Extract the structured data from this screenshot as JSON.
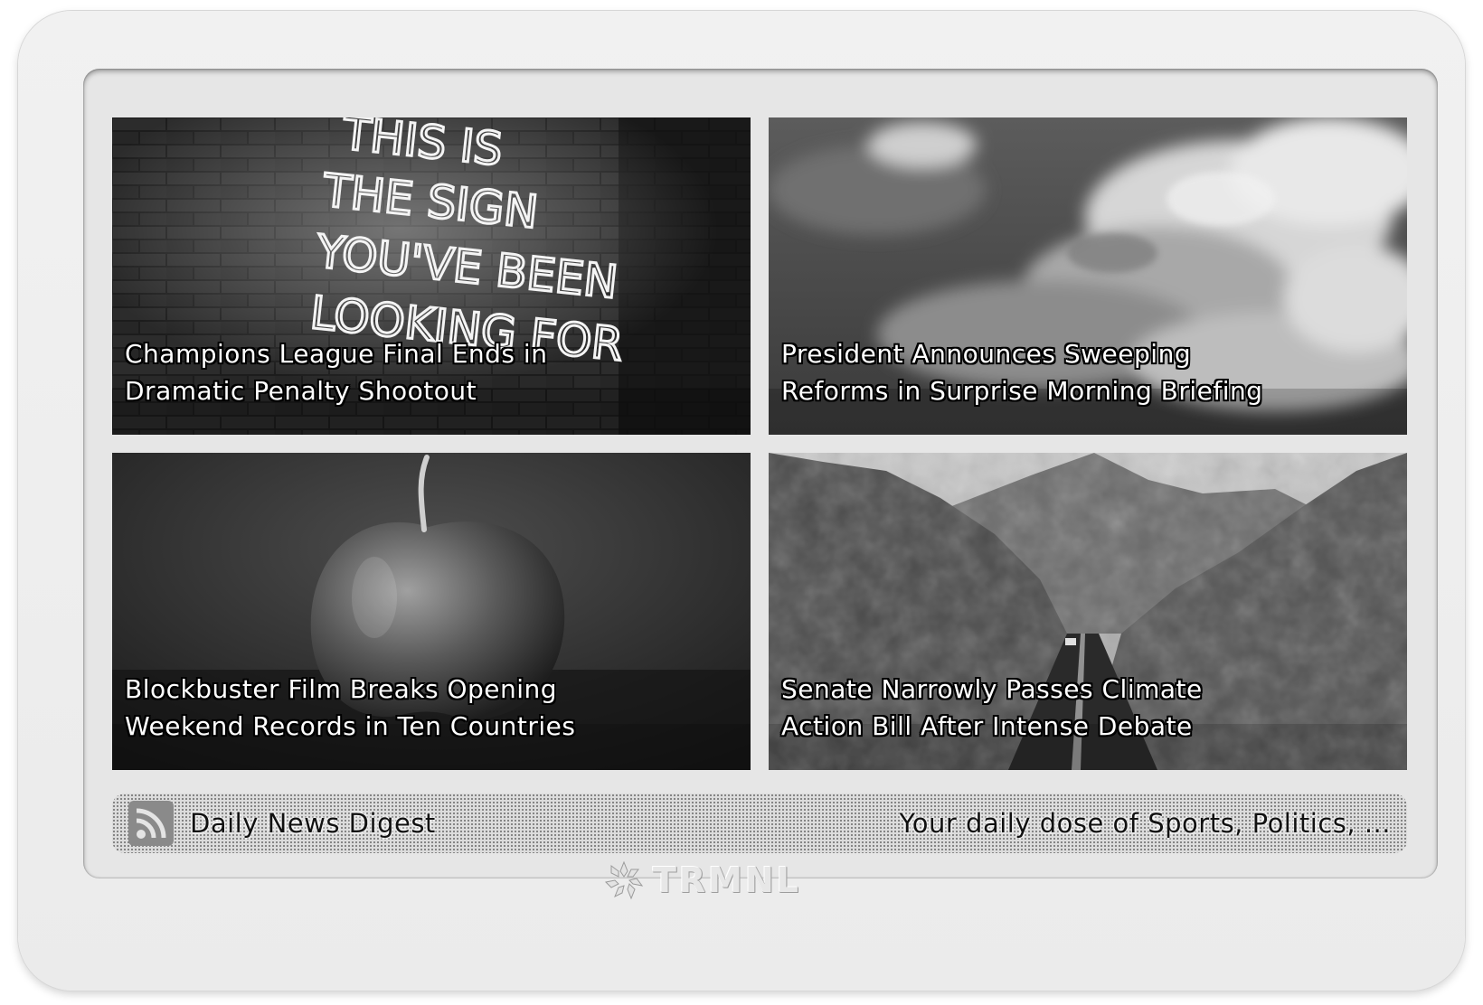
{
  "device": {
    "brand": "TRMNL"
  },
  "articles": [
    {
      "headline_line1": "Champions League Final Ends in",
      "headline_line2": "Dramatic Penalty Shootout",
      "image": "neon-sign-brick-wall",
      "neon_text": [
        "THIS IS",
        "THE SIGN",
        "YOU'VE BEEN",
        "LOOKING FOR"
      ]
    },
    {
      "headline_line1": "President Announces Sweeping",
      "headline_line2": "Reforms in Surprise Morning Briefing",
      "image": "cloudy-sky"
    },
    {
      "headline_line1": "Blockbuster Film Breaks Opening",
      "headline_line2": "Weekend Records in Ten Countries",
      "image": "apple"
    },
    {
      "headline_line1": "Senate Narrowly Passes Climate",
      "headline_line2": "Action Bill After Intense Debate",
      "image": "desert-road-mountains"
    }
  ],
  "footer": {
    "icon": "rss-icon",
    "title": "Daily News Digest",
    "description": "Your daily dose of Sports, Politics, ..."
  },
  "colors": {
    "device_bezel": "#ebebeb",
    "screen_background": "#e6e6e6",
    "text": "#111111"
  }
}
